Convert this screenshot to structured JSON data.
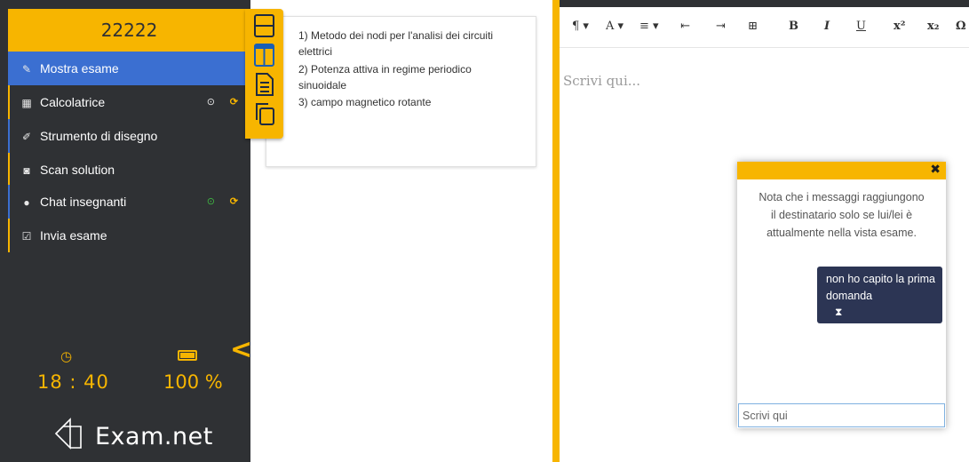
{
  "sidebar": {
    "exam_code": "22222",
    "items": [
      {
        "label": "Mostra esame",
        "icon": "edit-icon"
      },
      {
        "label": "Calcolatrice",
        "icon": "calculator-icon"
      },
      {
        "label": "Strumento di disegno",
        "icon": "brush-icon"
      },
      {
        "label": "Scan solution",
        "icon": "camera-icon"
      },
      {
        "label": "Chat insegnanti",
        "icon": "chat-icon"
      },
      {
        "label": "Invia esame",
        "icon": "submit-icon"
      }
    ],
    "time": "18 : 40",
    "battery": "100 %",
    "logo_text": "Exam.net",
    "colors": {
      "accent": "#f7b500",
      "active": "#3b6fd1",
      "bg": "#2f3134"
    }
  },
  "questions": {
    "lines": [
      "1) Metodo dei nodi per l'analisi dei circuiti",
      "elettrici",
      "2) Potenza attiva in regime periodico",
      "sinuoidale",
      "3) campo magnetico rotante"
    ]
  },
  "editor": {
    "toolbar": [
      "¶ ▾",
      "A ▾",
      "≡ ▾",
      "⇤",
      "⇥",
      "⊞",
      "B",
      "I",
      "U",
      "x²",
      "x₂",
      "Ω"
    ],
    "placeholder": "Scrivi qui..."
  },
  "chat": {
    "note": "Nota che i messaggi raggiungono il destinatario solo se lui/lei è attualmente nella vista esame.",
    "message": "non ho capito la prima domanda",
    "input_placeholder": "Scrivi qui"
  }
}
